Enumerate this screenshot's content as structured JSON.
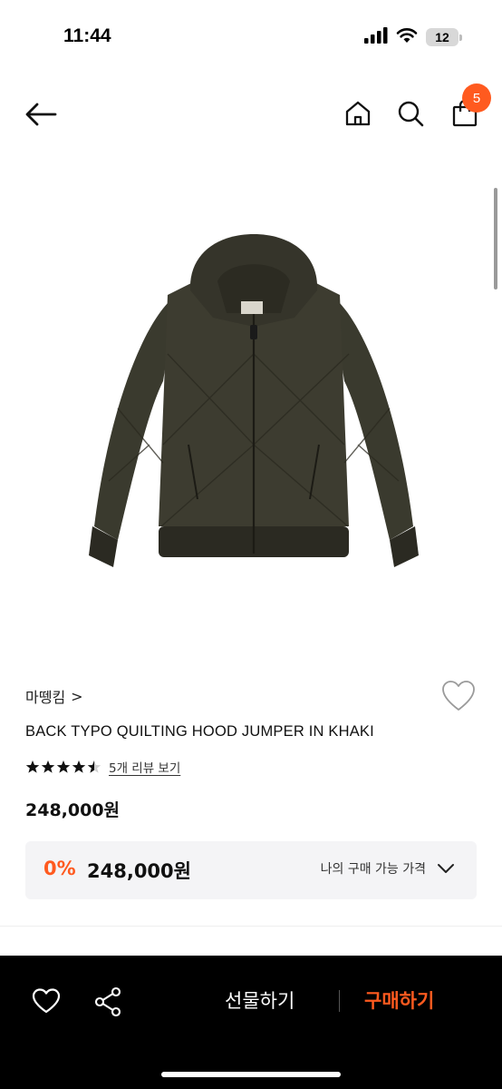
{
  "status_bar": {
    "time": "11:44",
    "battery": "12",
    "icons": [
      "signal-icon",
      "wifi-icon",
      "battery-icon"
    ]
  },
  "nav": {
    "icons": [
      "back-arrow-icon",
      "home-icon",
      "search-icon",
      "shopping-bag-icon"
    ],
    "cart_count": "5"
  },
  "product": {
    "image_subject": "khaki quilted hooded jumper",
    "brand": "마뗑킴",
    "brand_chevron": ">",
    "title": "BACK TYPO QUILTING HOOD JUMPER IN KHAKI",
    "rating": 4.5,
    "review_link": "5개 리뷰 보기",
    "price": "248,000원"
  },
  "price_box": {
    "discount_rate": "0%",
    "my_price": "248,000원",
    "label": "나의 구매 가능 가격"
  },
  "bottom_bar": {
    "gift_label": "선물하기",
    "buy_label": "구매하기",
    "icons": [
      "heart-icon",
      "share-icon"
    ]
  },
  "colors": {
    "accent": "#ff5a1f",
    "bottom_bar_bg": "#000000",
    "price_box_bg": "#f4f4f6"
  }
}
